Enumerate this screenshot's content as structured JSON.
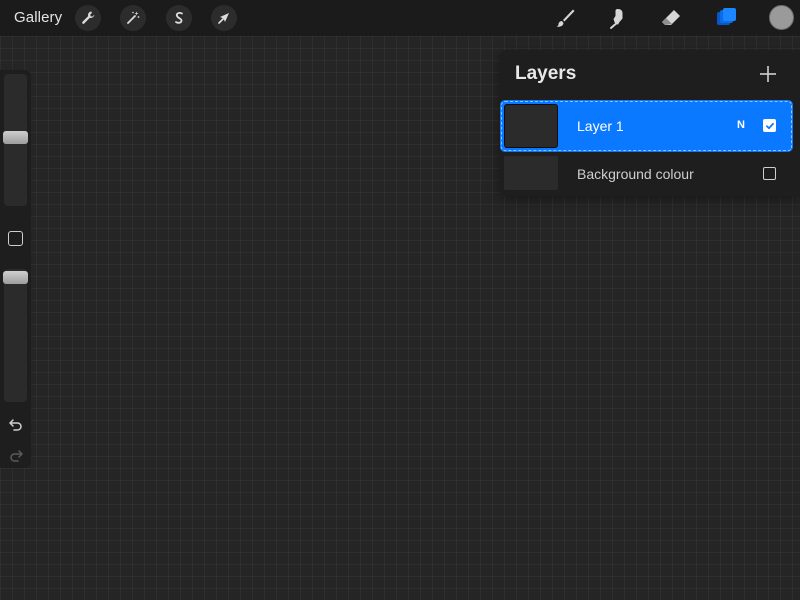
{
  "toolbar": {
    "gallery_label": "Gallery",
    "left_tools": [
      {
        "icon": "wrench-icon",
        "name": "actions"
      },
      {
        "icon": "magic-wand-icon",
        "name": "adjustments"
      },
      {
        "icon": "selection-icon",
        "name": "selection"
      },
      {
        "icon": "arrow-cursor-icon",
        "name": "transform"
      }
    ],
    "right_tools": [
      {
        "icon": "brush-icon",
        "name": "paint"
      },
      {
        "icon": "smudge-icon",
        "name": "smudge"
      },
      {
        "icon": "eraser-icon",
        "name": "erase"
      },
      {
        "icon": "layers-icon",
        "name": "layers",
        "active": true
      }
    ],
    "current_color": "#9a9a9a",
    "accent_color": "#0a79ff"
  },
  "sidebar": {
    "brush_size_level": 0.52,
    "opacity_level": 1.0
  },
  "layers_panel": {
    "title": "Layers",
    "layers": [
      {
        "name": "Layer 1",
        "blend_mode": "N",
        "visible": true,
        "selected": true
      },
      {
        "name": "Background colour",
        "visible": false,
        "selected": false
      }
    ]
  }
}
